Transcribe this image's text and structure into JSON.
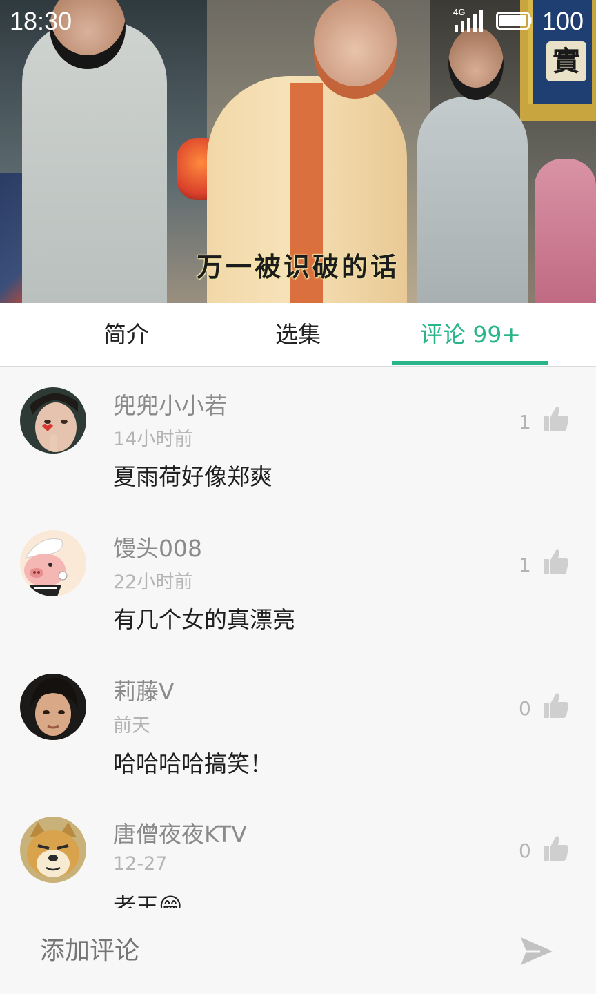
{
  "status_bar": {
    "time": "18:30",
    "network": "4G",
    "battery": "100"
  },
  "video": {
    "subtitle": "万一被识破的话",
    "sign_glyph": "實"
  },
  "tabs": [
    {
      "label": "简介",
      "active": false
    },
    {
      "label": "选集",
      "active": false
    },
    {
      "label": "评论 99+",
      "active": true
    }
  ],
  "comments": [
    {
      "user": "兜兜小小若",
      "time": "14小时前",
      "text": "夏雨荷好像郑爽",
      "likes": "1"
    },
    {
      "user": "馒头008",
      "time": "22小时前",
      "text": "有几个女的真漂亮",
      "likes": "1"
    },
    {
      "user": "莉藤V",
      "time": "前天",
      "text": "哈哈哈哈搞笑！",
      "likes": "0"
    },
    {
      "user": "唐僧夜夜KTV",
      "time": "12-27",
      "text": "老王😁",
      "likes": "0"
    }
  ],
  "comment_input": {
    "placeholder": "添加评论"
  },
  "colors": {
    "accent": "#29b48a",
    "username": "#8a8a8a",
    "meta": "#b4b4b4"
  }
}
